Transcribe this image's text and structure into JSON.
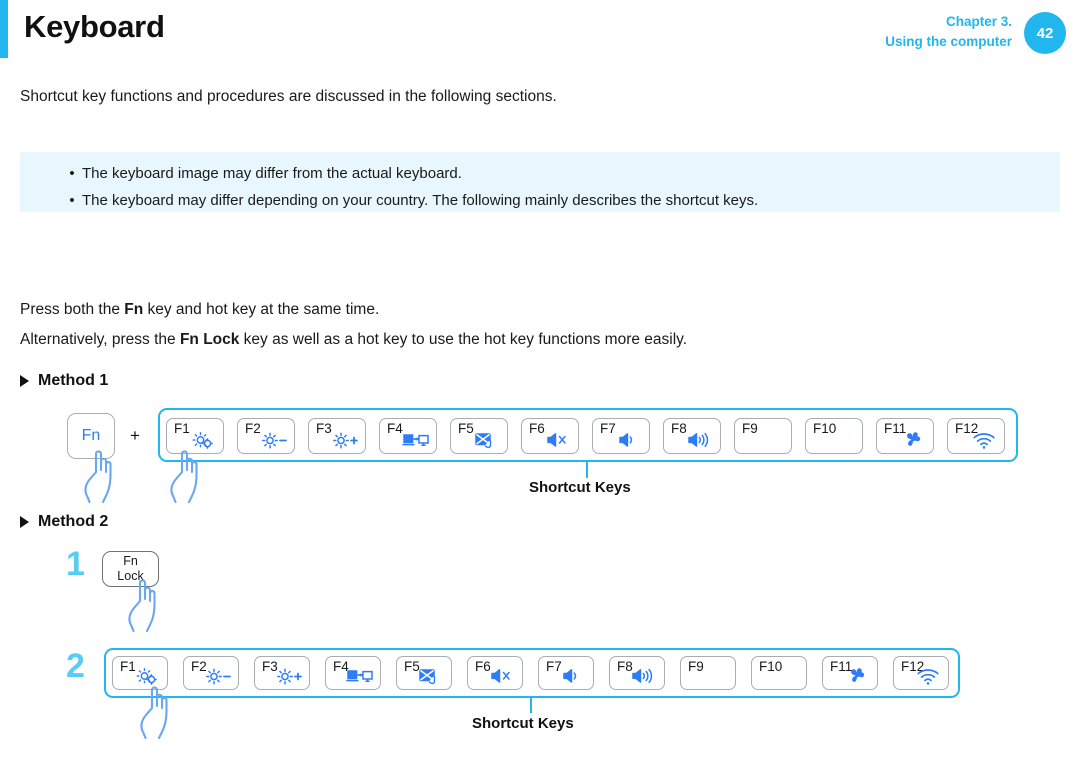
{
  "header": {
    "title": "Keyboard",
    "chapter_line1": "Chapter 3.",
    "chapter_line2": "Using the computer",
    "page_number": "42",
    "accent_color": "#22b6ef"
  },
  "intro": "Shortcut key functions and procedures are discussed in the following sections.",
  "note": {
    "bullet_glyph": "•",
    "items": [
      "The keyboard image may differ from the actual keyboard.",
      "The keyboard may differ depending on your country. The following mainly describes the shortcut keys."
    ]
  },
  "body": {
    "line1_pre": "Press both the ",
    "line1_bold": "Fn",
    "line1_post": " key and hot key at the same time.",
    "line2_pre": "Alternatively, press the ",
    "line2_bold": "Fn Lock",
    "line2_post": " key as well as a hot key to use the hot key functions more easily."
  },
  "methods": {
    "method1_label": "Method 1",
    "method2_label": "Method 2"
  },
  "method1": {
    "fn_key_label": "Fn",
    "plus_symbol": "+",
    "callout_label": "Shortcut Keys"
  },
  "method2": {
    "step1_number": "1",
    "step2_number": "2",
    "fnlock_line1": "Fn",
    "fnlock_line2": "Lock",
    "callout_label": "Shortcut Keys"
  },
  "function_keys": [
    {
      "label": "F1",
      "icon": "settings-gear-icon"
    },
    {
      "label": "F2",
      "icon": "brightness-down-icon"
    },
    {
      "label": "F3",
      "icon": "brightness-up-icon"
    },
    {
      "label": "F4",
      "icon": "external-display-icon"
    },
    {
      "label": "F5",
      "icon": "touchpad-off-icon"
    },
    {
      "label": "F6",
      "icon": "mute-icon"
    },
    {
      "label": "F7",
      "icon": "volume-down-icon"
    },
    {
      "label": "F8",
      "icon": "volume-up-icon"
    },
    {
      "label": "F9",
      "icon": "none"
    },
    {
      "label": "F10",
      "icon": "none"
    },
    {
      "label": "F11",
      "icon": "fan-silent-mode-icon"
    },
    {
      "label": "F12",
      "icon": "wireless-icon"
    }
  ],
  "colors": {
    "brand_blue": "#22b6ef",
    "icon_blue": "#2e7df5",
    "note_bg": "#e8f6fd",
    "step_number_blue": "#57cdf5",
    "key_border": "#a9adb2"
  }
}
